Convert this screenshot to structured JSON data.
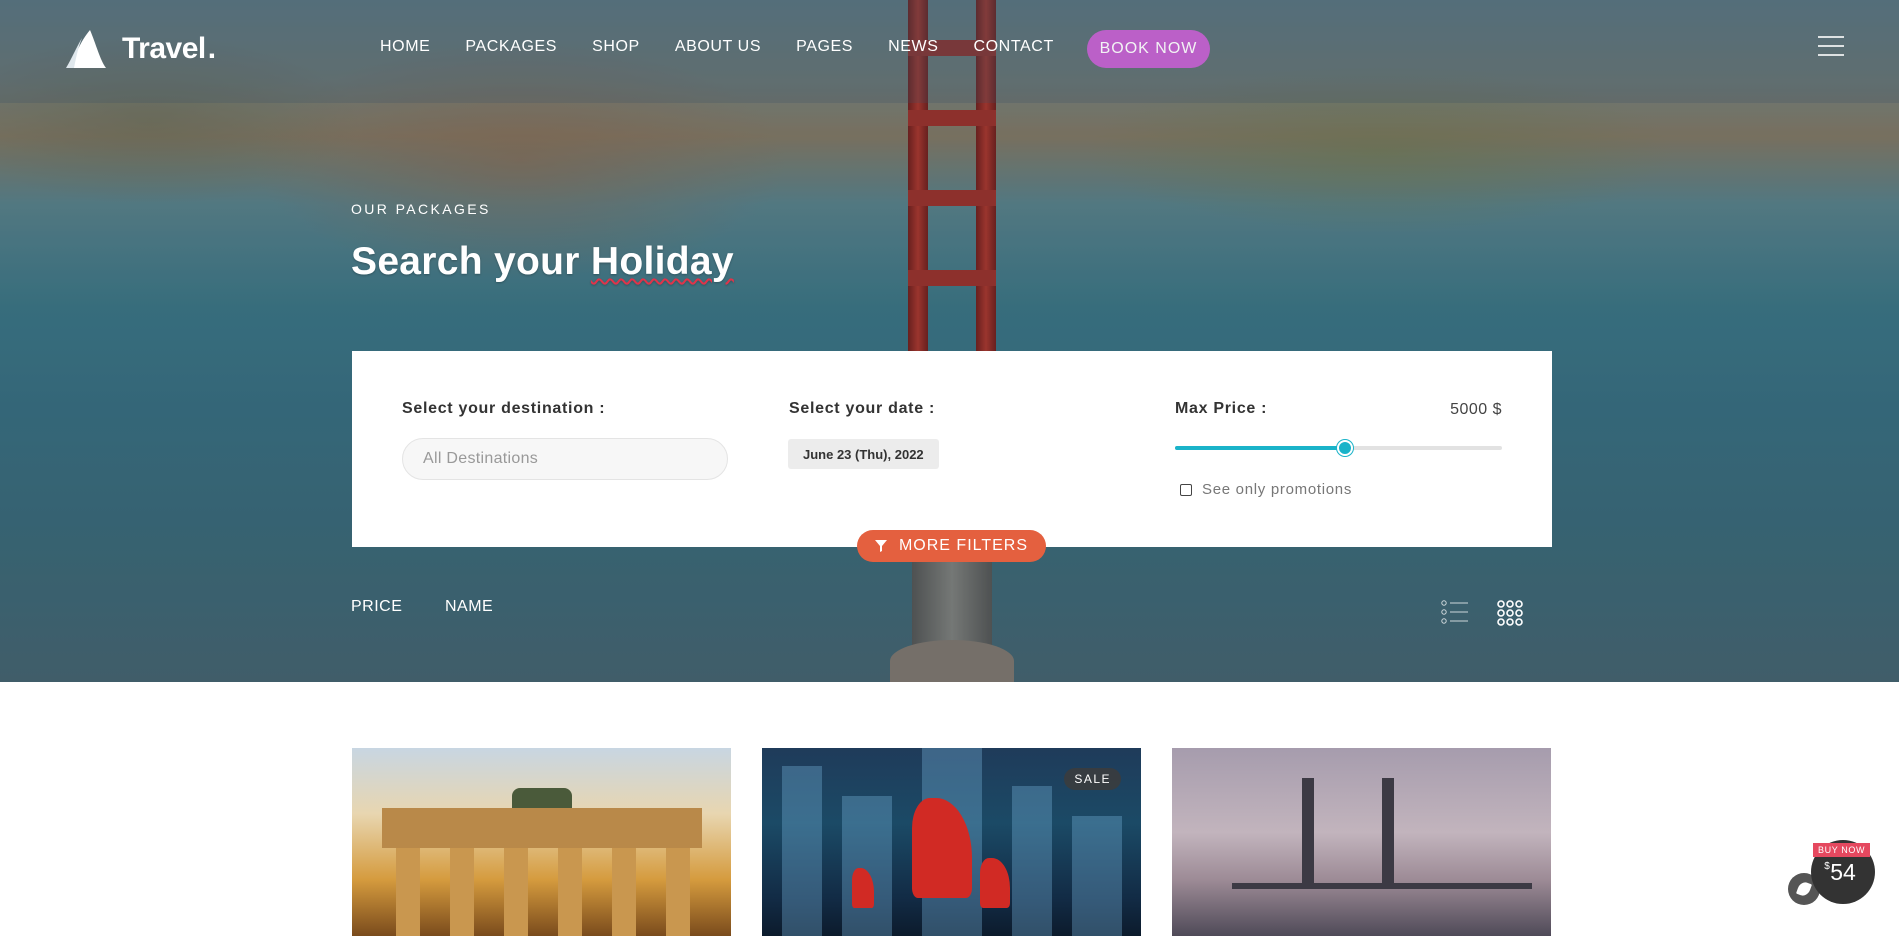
{
  "header": {
    "logo_text": "Travel",
    "logo_dot": ".",
    "nav": [
      "HOME",
      "PACKAGES",
      "SHOP",
      "ABOUT US",
      "PAGES",
      "NEWS",
      "CONTACT"
    ],
    "book_label": "BOOK NOW"
  },
  "hero": {
    "eyebrow": "OUR PACKAGES",
    "title_start": "Search your ",
    "title_highlight": "Holiday"
  },
  "search": {
    "destination_label": "Select your destination :",
    "destination_placeholder": "All Destinations",
    "date_label": "Select your date :",
    "date_value": "June 23 (Thu), 2022",
    "price_label": "Max Price :",
    "price_value": "5000 $",
    "price_fraction": 0.52,
    "promo_label": "See only promotions",
    "more_filters_label": "MORE FILTERS"
  },
  "sort": {
    "price_label": "PRICE",
    "name_label": "NAME"
  },
  "cards": [
    {
      "badge": ""
    },
    {
      "badge": "SALE"
    },
    {
      "badge": ""
    }
  ],
  "buy_widget": {
    "tag": "BUY NOW",
    "currency": "$",
    "price": "54"
  },
  "colors": {
    "accent_purple": "#c45fd0",
    "accent_orange": "#e4603f",
    "slider_teal": "#1ab3c9",
    "buy_tag_red": "#e5485f"
  }
}
